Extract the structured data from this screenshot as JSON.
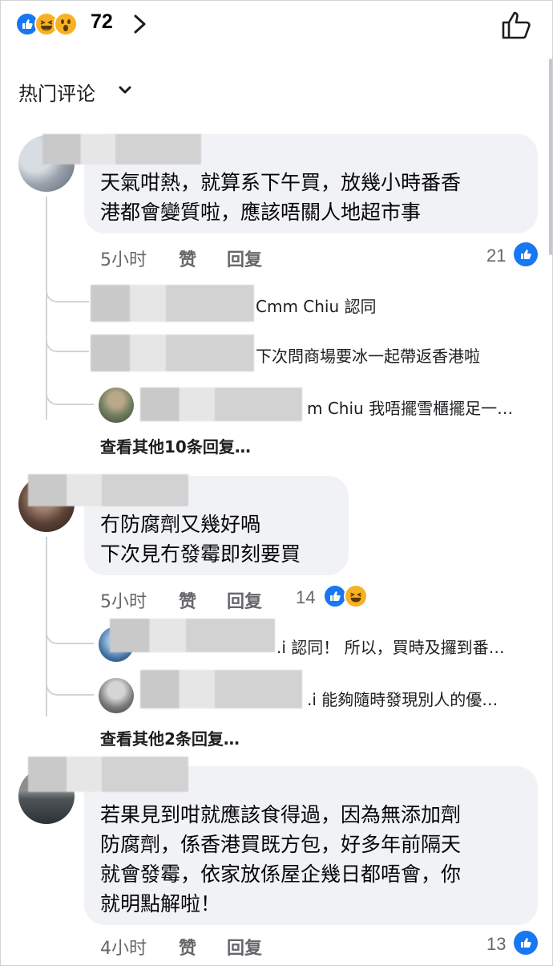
{
  "header": {
    "reaction_count": "72",
    "reaction_icons": [
      "like-icon",
      "haha-icon",
      "wow-icon"
    ]
  },
  "sort": {
    "label": "热门评论"
  },
  "comments": [
    {
      "text_lines": [
        "天氣咁熱，就算系下午買，放幾小時番香",
        "港都會變質啦，應該唔關人地超市事"
      ],
      "time": "5小时",
      "like_label": "赞",
      "reply_label": "回复",
      "reaction_count": "21",
      "replies": [
        {
          "text": "Cmm Chiu 認同"
        },
        {
          "text": "下次問商場要冰一起帶返香港啦"
        },
        {
          "text": "m Chiu 我唔擺雪櫃擺足一…"
        }
      ],
      "more_replies": "查看其他10条回复…"
    },
    {
      "text_lines": [
        "冇防腐劑又幾好喎",
        "下次見冇發霉即刻要買"
      ],
      "time": "5小时",
      "like_label": "赞",
      "reply_label": "回复",
      "reaction_count": "14",
      "replies": [
        {
          "text": ".i 認同！ 所以，買時及攞到番…"
        },
        {
          "text": ".i 能夠隨時發現別人的優…"
        }
      ],
      "more_replies": "查看其他2条回复…"
    },
    {
      "text_lines": [
        "若果見到咁就應該食得過，因為無添加劑",
        "防腐劑，係香港買既方包，好多年前隔天",
        "就會發霉，依家放係屋企幾日都唔會，你",
        "就明點解啦！"
      ],
      "time": "4小时",
      "like_label": "赞",
      "reply_label": "回复",
      "reaction_count": "13"
    }
  ],
  "colors": {
    "like_blue": "#1877f2",
    "haha_yellow": "#f7b125",
    "bubble_bg": "#f0f2f5",
    "meta_gray": "#65676b"
  }
}
